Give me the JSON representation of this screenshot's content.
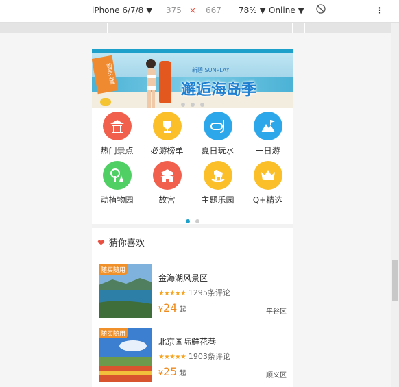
{
  "devtools": {
    "device": "iPhone 6/7/8 ▼",
    "width": "375",
    "times": "×",
    "height": "667",
    "zoom": "78% ▼",
    "network": "Online ▼",
    "more": "⋮"
  },
  "banner": {
    "brand": "新碧 SUNPLAY",
    "slogan": "邂逅海岛季",
    "ribbon": "购买立减"
  },
  "categories": [
    {
      "label": "热门景点",
      "icon": "pavilion-icon",
      "color": "#f1604c"
    },
    {
      "label": "必游榜单",
      "icon": "trophy-icon",
      "color": "#fbbf2a"
    },
    {
      "label": "夏日玩水",
      "icon": "snorkel-icon",
      "color": "#2ca8ea"
    },
    {
      "label": "一日游",
      "icon": "mountain-flag-icon",
      "color": "#2ca8ea"
    },
    {
      "label": "动植物园",
      "icon": "tree-icon",
      "color": "#4fcf64"
    },
    {
      "label": "故宫",
      "icon": "palace-icon",
      "color": "#f1604c"
    },
    {
      "label": "主题乐园",
      "icon": "rocking-horse-icon",
      "color": "#fbbf2a"
    },
    {
      "label": "Q+精选",
      "icon": "crown-icon",
      "color": "#fbbf2a"
    }
  ],
  "section": {
    "title": "猜你喜欢"
  },
  "items": [
    {
      "tag": "随买随用",
      "title": "金海湖风景区",
      "stars": "★★★★★",
      "reviews": "1295条评论",
      "currency": "¥",
      "price": "24",
      "price_suffix": "起",
      "district": "平谷区"
    },
    {
      "tag": "随买随用",
      "title": "北京国际鲜花巷",
      "stars": "★★★★★",
      "reviews": "1903条评论",
      "currency": "¥",
      "price": "25",
      "price_suffix": "起",
      "district": "顺义区"
    }
  ]
}
